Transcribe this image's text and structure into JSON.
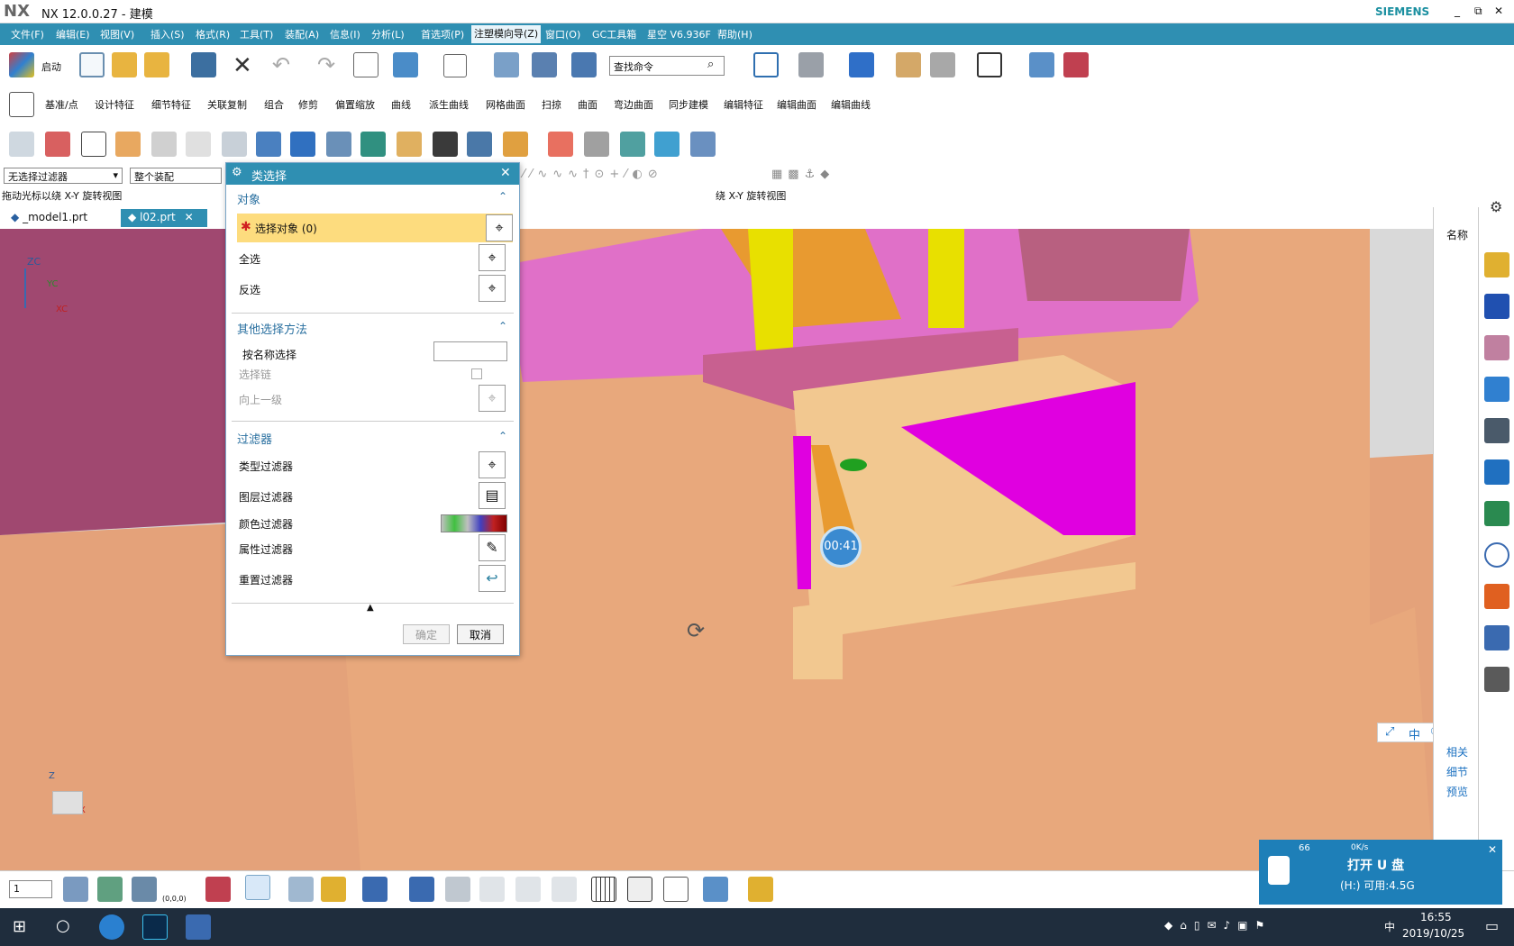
{
  "app": {
    "logo": "NX",
    "title": "NX 12.0.0.27 - 建模",
    "brand": "SIEMENS",
    "window_buttons": [
      "_",
      "⧉",
      "✕"
    ]
  },
  "menu": [
    "文件(F)",
    "编辑(E)",
    "视图(V)",
    "插入(S)",
    "格式(R)",
    "工具(T)",
    "装配(A)",
    "信息(I)",
    "分析(L)",
    "首选项(P)",
    "注塑模向导(Z)",
    "窗口(O)",
    "GC工具箱",
    "星空 V6.936F",
    "帮助(H)"
  ],
  "toolbar": {
    "start_label": "启动",
    "search_placeholder": "查找命令"
  },
  "toolbar2": [
    "基准/点",
    "设计特征",
    "细节特征",
    "关联复制",
    "组合",
    "修剪",
    "偏置缩放",
    "曲线",
    "派生曲线",
    "网格曲面",
    "扫掠",
    "曲面",
    "弯边曲面",
    "同步建模",
    "编辑特征",
    "编辑曲面",
    "编辑曲线"
  ],
  "selection": {
    "filter": "无选择过滤器",
    "scope": "整个装配"
  },
  "status": {
    "left": "拖动光标以绕 X-Y 旋转视图",
    "center": "绕 X-Y 旋转视图"
  },
  "tabs": [
    {
      "label": "_model1.prt"
    },
    {
      "label": "l02.prt"
    }
  ],
  "viewport": {
    "axis_zc": "ZC",
    "axis_yc": "YC",
    "axis_xc": "XC",
    "axis_z": "Z",
    "axis_x": "X",
    "timer": "00:41"
  },
  "right_panel": {
    "header": "名称",
    "links": [
      "相关",
      "细节",
      "预览"
    ]
  },
  "dialog": {
    "title": "类选择",
    "section_object": "对象",
    "select_object": "选择对象 (0)",
    "select_all": "全选",
    "invert": "反选",
    "section_other": "其他选择方法",
    "by_name": "按名称选择",
    "select_chain": "选择链",
    "up_level": "向上一级",
    "section_filter": "过滤器",
    "type_filter": "类型过滤器",
    "layer_filter": "图层过滤器",
    "color_filter": "颜色过滤器",
    "attr_filter": "属性过滤器",
    "reset_filter": "重置过滤器",
    "ok": "确定",
    "cancel": "取消"
  },
  "bottom": {
    "layer": "1",
    "origin": "(0,0,0)"
  },
  "usb": {
    "title": "打开 U 盘",
    "info": "(H:)  可用:4.5G",
    "speed": "0K/s",
    "pct": "66"
  },
  "ime": {
    "mode": "中"
  },
  "taskbar": {
    "time": "16:55",
    "date": "2019/10/25",
    "lang": "中"
  },
  "colors": {
    "accent": "#2f8fb2",
    "model_tan": "#e4a27a",
    "model_pink": "#e070c8",
    "model_magenta": "#e000e0",
    "model_yellow": "#eaea00"
  }
}
